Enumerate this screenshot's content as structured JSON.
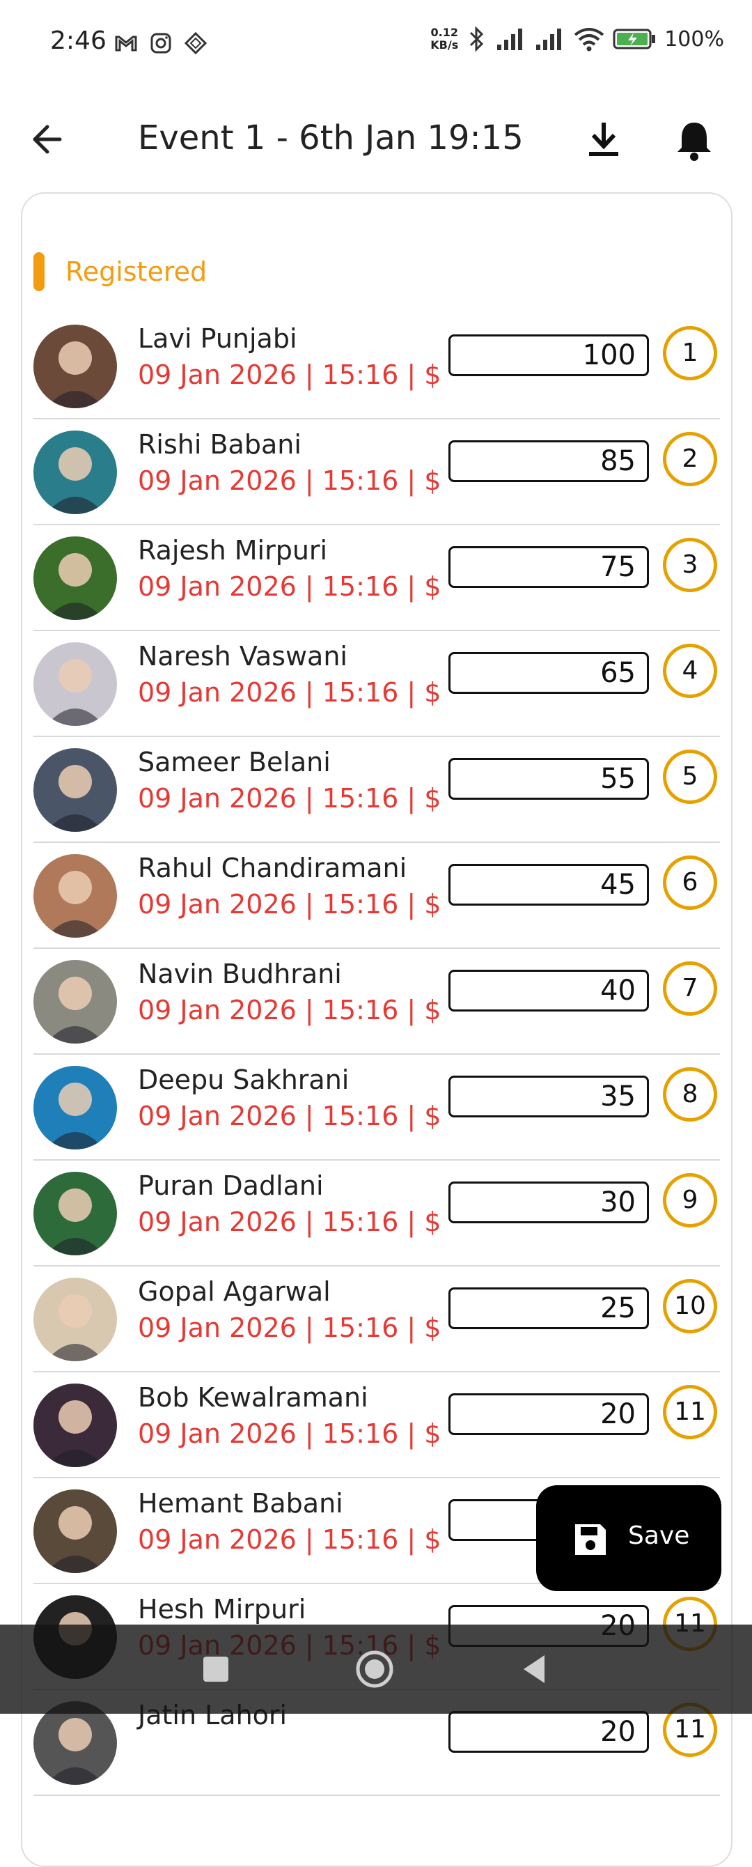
{
  "status_bar": {
    "time": "2:46",
    "net_speed_value": "0.12",
    "net_speed_unit": "KB/s",
    "battery": "100%"
  },
  "app_bar": {
    "title": "Event 1 - 6th Jan 19:15"
  },
  "section": {
    "label": "Registered",
    "accent": "#f39c12"
  },
  "players": [
    {
      "name": "Lavi Punjabi",
      "meta": "09 Jan 2026 | 15:16 | $",
      "points": "100",
      "rank": "1",
      "avatar_color": "#6b4a3a"
    },
    {
      "name": "Rishi Babani",
      "meta": "09 Jan 2026 | 15:16 | $",
      "points": "85",
      "rank": "2",
      "avatar_color": "#2a7d8a"
    },
    {
      "name": "Rajesh Mirpuri",
      "meta": "09 Jan 2026 | 15:16 | $",
      "points": "75",
      "rank": "3",
      "avatar_color": "#3a6e2a"
    },
    {
      "name": "Naresh Vaswani",
      "meta": "09 Jan 2026 | 15:16 | $",
      "points": "65",
      "rank": "4",
      "avatar_color": "#c9c6cf"
    },
    {
      "name": "Sameer Belani",
      "meta": "09 Jan 2026 | 15:16 | $",
      "points": "55",
      "rank": "5",
      "avatar_color": "#4a5668"
    },
    {
      "name": "Rahul Chandiramani",
      "meta": "09 Jan 2026 | 15:16 | $",
      "points": "45",
      "rank": "6",
      "avatar_color": "#b07a5a"
    },
    {
      "name": "Navin Budhrani",
      "meta": "09 Jan 2026 | 15:16 | $",
      "points": "40",
      "rank": "7",
      "avatar_color": "#8a8a80"
    },
    {
      "name": "Deepu Sakhrani",
      "meta": "09 Jan 2026 | 15:16 | $",
      "points": "35",
      "rank": "8",
      "avatar_color": "#1f7fb8"
    },
    {
      "name": "Puran Dadlani",
      "meta": "09 Jan 2026 | 15:16 | $",
      "points": "30",
      "rank": "9",
      "avatar_color": "#2e6b3a"
    },
    {
      "name": "Gopal Agarwal",
      "meta": "09 Jan 2026 | 15:16 | $",
      "points": "25",
      "rank": "10",
      "avatar_color": "#d8c8b0"
    },
    {
      "name": "Bob Kewalramani",
      "meta": "09 Jan 2026 | 15:16 | $",
      "points": "20",
      "rank": "11",
      "avatar_color": "#3a2a3a"
    },
    {
      "name": "Hemant Babani",
      "meta": "09 Jan 2026 | 15:16 | $",
      "points": "",
      "rank": "",
      "avatar_color": "#5a4a3a"
    },
    {
      "name": "Hesh Mirpuri",
      "meta": "09 Jan 2026 | 15:16 | $",
      "points": "20",
      "rank": "11",
      "avatar_color": "#222222"
    },
    {
      "name": "Jatin Lahori",
      "meta": "",
      "points": "20",
      "rank": "11",
      "avatar_color": "#555555"
    }
  ],
  "save_button": {
    "label": "Save"
  },
  "colors": {
    "meta_text": "#e53935",
    "rank_ring": "#e5a100"
  }
}
